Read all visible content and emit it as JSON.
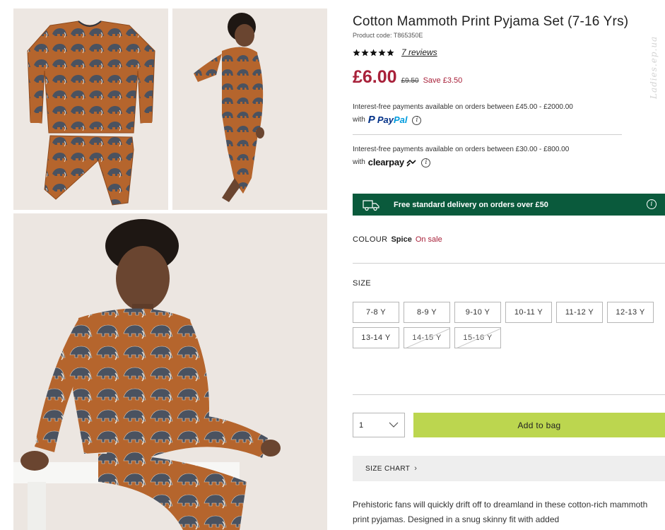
{
  "gallery": {
    "images": [
      {
        "alt": "flat-lay",
        "icon": "mammoth-print"
      },
      {
        "alt": "back-view",
        "icon": "mammoth-print"
      },
      {
        "alt": "sitting-view",
        "icon": "mammoth-print"
      }
    ]
  },
  "watermark": "Ladies.ep.ua",
  "product": {
    "title": "Cotton Mammoth Print Pyjama Set (7-16 Yrs)",
    "code": "Product code: T865350E",
    "rating": {
      "stars": 5,
      "reviews_label": "7 reviews"
    },
    "price": {
      "now": "£6.00",
      "was": "£9.50",
      "save": "Save £3.50"
    }
  },
  "payments": {
    "paypal": {
      "text": "Interest-free payments available on orders between £45.00 - £2000.00",
      "with": "with",
      "logo_p": "P",
      "logo_pay": "Pay",
      "logo_pal": "Pal"
    },
    "clearpay": {
      "text": "Interest-free payments available on orders between £30.00 - £800.00",
      "with": "with",
      "logo": "clearpay"
    },
    "info_glyph": "i"
  },
  "delivery": {
    "text": "Free standard delivery on orders over £50",
    "icon": "truck-icon",
    "bg": "#0a5a3c"
  },
  "colour": {
    "label": "COLOUR",
    "value": "Spice",
    "sale": "On sale"
  },
  "size": {
    "label": "SIZE",
    "options": [
      {
        "label": "7-8 Y",
        "available": true
      },
      {
        "label": "8-9 Y",
        "available": true
      },
      {
        "label": "9-10 Y",
        "available": true
      },
      {
        "label": "10-11 Y",
        "available": true
      },
      {
        "label": "11-12 Y",
        "available": true
      },
      {
        "label": "12-13 Y",
        "available": true
      },
      {
        "label": "13-14 Y",
        "available": true
      },
      {
        "label": "14-15 Y",
        "available": false
      },
      {
        "label": "15-16 Y",
        "available": false
      }
    ]
  },
  "purchase": {
    "quantity": "1",
    "add_to_bag": "Add to bag",
    "accent": "#bcd64f"
  },
  "size_chart": {
    "label": "SIZE CHART",
    "chevron": "›"
  },
  "description": "Prehistoric fans will quickly drift off to dreamland in these cotton-rich mammoth print pyjamas. Designed in a snug skinny fit with added"
}
